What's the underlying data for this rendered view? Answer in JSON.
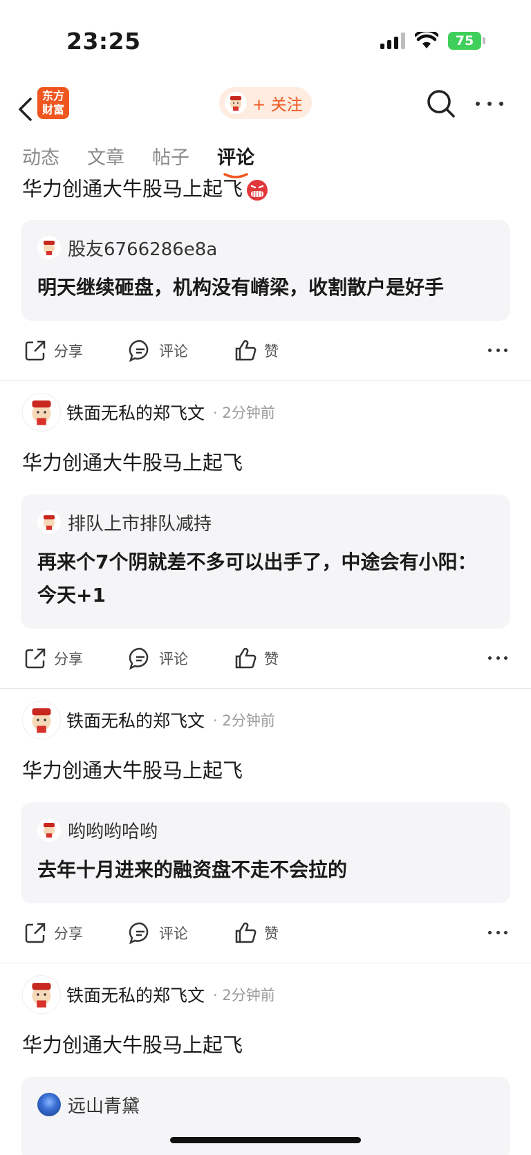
{
  "status_bar": {
    "time": "23:25",
    "battery": "75"
  },
  "nav": {
    "logo_text": "东方财富",
    "follow_label": "+ 关注",
    "icons": [
      "back-icon",
      "search-icon",
      "more-icon"
    ]
  },
  "tabs": [
    {
      "label": "动态",
      "active": false
    },
    {
      "label": "文章",
      "active": false
    },
    {
      "label": "帖子",
      "active": false
    },
    {
      "label": "评论",
      "active": true
    }
  ],
  "actions": {
    "share": "分享",
    "comment": "评论",
    "like": "赞"
  },
  "posts": [
    {
      "author": "",
      "time": "",
      "title": "华力创通大牛股马上起飞",
      "title_emoji": "angry-face-icon",
      "quote_author": "股友6766286e8a",
      "quote_text": "明天继续砸盘，机构没有嵴梁，收割散户是好手"
    },
    {
      "author": "铁面无私的郑飞文",
      "time": "· 2分钟前",
      "title": "华力创通大牛股马上起飞",
      "quote_author": "排队上市排队减持",
      "quote_text": "再来个7个阴就差不多可以出手了，中途会有小阳：今天+1"
    },
    {
      "author": "铁面无私的郑飞文",
      "time": "· 2分钟前",
      "title": "华力创通大牛股马上起飞",
      "quote_author": "哟哟哟哈哟",
      "quote_text": "去年十月进来的融资盘不走不会拉的"
    },
    {
      "author": "铁面无私的郑飞文",
      "time": "· 2分钟前",
      "title": "华力创通大牛股马上起飞",
      "quote_author": "远山青黛",
      "quote_text": ""
    }
  ],
  "colors": {
    "brand": "#f0561f",
    "follow_bg": "#fdecdf",
    "quote_bg": "#f5f5f7",
    "battery": "#3fcf5a"
  }
}
